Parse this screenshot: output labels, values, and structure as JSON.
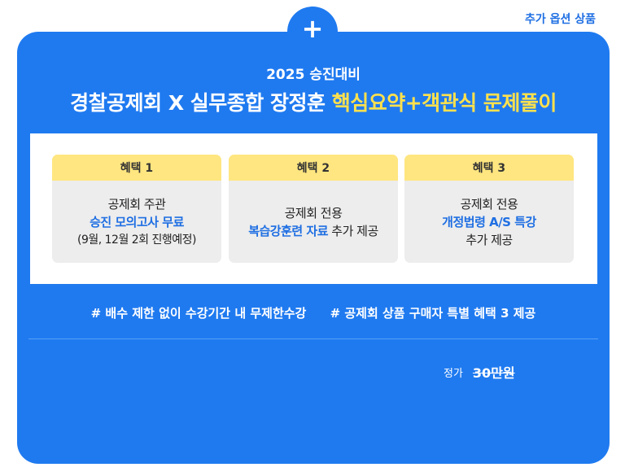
{
  "corner_label": "추가 옵션 상품",
  "plus_symbol": "+",
  "subtitle": "2025 승진대비",
  "title": {
    "main": "경찰공제회 X 실무종합 장정훈 ",
    "highlight": "핵심요약+객관식 문제풀이"
  },
  "benefits": [
    {
      "label": "혜택 1",
      "line1": "공제회 주관",
      "line2_blue": "승진 모의고사 무료",
      "line3": "(9월, 12월 2회 진행예정)"
    },
    {
      "label": "혜택 2",
      "line1": "공제회 전용",
      "line2_blue": "복습강훈련 자료",
      "line2_rest": " 추가 제공"
    },
    {
      "label": "혜택 3",
      "line1": "공제회 전용",
      "line2_blue": "개정법령 A/S 특강",
      "line3": "추가 제공"
    }
  ],
  "tags": [
    "# 배수 제한 없이 수강기간 내 무제한수강",
    "# 공제회 상품 구매자 특별 혜택 3 제공"
  ],
  "price": {
    "label": "정가",
    "value": "30만원"
  },
  "colors": {
    "primary": "#1f7af0",
    "highlight": "#ffe14d",
    "badge": "#ffe680"
  }
}
